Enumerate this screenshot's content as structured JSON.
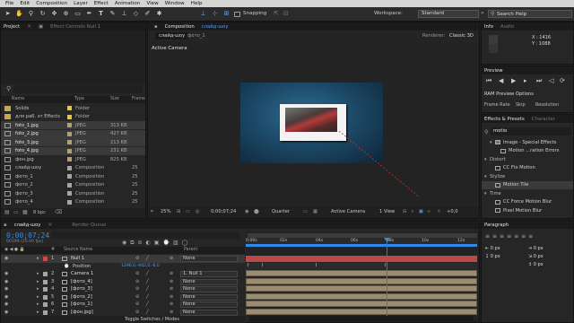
{
  "menu": [
    "File",
    "Edit",
    "Composition",
    "Layer",
    "Effect",
    "Animation",
    "View",
    "Window",
    "Help"
  ],
  "toolbar": {
    "snapping": "Snapping",
    "workspace_label": "Workspace:",
    "workspace_value": "Standard",
    "search_help": "Search Help"
  },
  "project": {
    "tab": "Project",
    "effect_controls_tab": "Effect Controls Null 1",
    "search_placeholder": "",
    "headers": {
      "name": "Name",
      "type": "Type",
      "size": "Size",
      "frame": "Frame"
    },
    "items": [
      {
        "name": "Solids",
        "type": "Folder",
        "size": "",
        "frame": "",
        "color": "#e7c44a",
        "kind": "folder"
      },
      {
        "name": "для ра6. эт Effects",
        "type": "Folder",
        "size": "",
        "frame": "",
        "color": "#e7c44a",
        "kind": "folder"
      },
      {
        "name": "foto_1.jpg",
        "type": "JPEG",
        "size": "313 KB",
        "frame": "",
        "color": "#b6a06d",
        "kind": "file",
        "selected": true
      },
      {
        "name": "foto_2.jpg",
        "type": "JPEG",
        "size": "427 KB",
        "frame": "",
        "color": "#b6a06d",
        "kind": "file",
        "selected": true
      },
      {
        "name": "foto_3.jpg",
        "type": "JPEG",
        "size": "213 KB",
        "frame": "",
        "color": "#b6a06d",
        "kind": "file",
        "selected": true
      },
      {
        "name": "foto_4.jpg",
        "type": "JPEG",
        "size": "231 KB",
        "frame": "",
        "color": "#b6a06d",
        "kind": "file",
        "selected": true
      },
      {
        "name": "фон.jpg",
        "type": "JPEG",
        "size": "825 KB",
        "frame": "",
        "color": "#b6a06d",
        "kind": "file"
      },
      {
        "name": "слайд-шоу",
        "type": "Composition",
        "size": "",
        "frame": "25",
        "color": "#a5a5a5",
        "kind": "comp"
      },
      {
        "name": "фото_1",
        "type": "Composition",
        "size": "",
        "frame": "25",
        "color": "#a5a5a5",
        "kind": "comp"
      },
      {
        "name": "фото_2",
        "type": "Composition",
        "size": "",
        "frame": "25",
        "color": "#a5a5a5",
        "kind": "comp"
      },
      {
        "name": "фото_3",
        "type": "Composition",
        "size": "",
        "frame": "25",
        "color": "#a5a5a5",
        "kind": "comp"
      },
      {
        "name": "фото_4",
        "type": "Composition",
        "size": "",
        "frame": "25",
        "color": "#a5a5a5",
        "kind": "comp"
      }
    ],
    "bpc": "8 bpc"
  },
  "composition": {
    "tab": "Composition",
    "tab_comp": "слайд-шоу",
    "subtab_active": "слайд-шоу",
    "subtab_other": "фото_1",
    "renderer_label": "Renderer:",
    "renderer_value": "Classic 3D",
    "view_label": "Active Camera",
    "footer": {
      "zoom": "25%",
      "time": "0;00;07;24",
      "resolution": "Quarter",
      "camera": "Active Camera",
      "views": "1 View",
      "offset": "+0,0"
    }
  },
  "info": {
    "tab": "Info",
    "audio_tab": "Audio",
    "x": "X : 1416",
    "y": "Y : 1088"
  },
  "preview": {
    "tab": "Preview",
    "ram": "RAM Preview Options",
    "frame_rate": "Frame Rate",
    "skip": "Skip",
    "resolution": "Resolution"
  },
  "effects": {
    "tab": "Effects & Presets",
    "char_tab": "Character",
    "search_value": "motio",
    "items": [
      {
        "label": "Image - Special Effects",
        "indent": 1,
        "kind": "folder"
      },
      {
        "label": "Motion ...ration Errors",
        "indent": 2,
        "kind": "effect"
      },
      {
        "label": "Distort",
        "indent": 0,
        "kind": "cat"
      },
      {
        "label": "CC Flo Motion",
        "indent": 1,
        "kind": "effect"
      },
      {
        "label": "Stylize",
        "indent": 0,
        "kind": "cat"
      },
      {
        "label": "Motion Tile",
        "indent": 1,
        "kind": "effect",
        "selected": true
      },
      {
        "label": "Time",
        "indent": 0,
        "kind": "cat"
      },
      {
        "label": "CC Force Motion Blur",
        "indent": 1,
        "kind": "effect"
      },
      {
        "label": "Pixel Motion Blur",
        "indent": 1,
        "kind": "effect"
      }
    ]
  },
  "paragraph": {
    "tab": "Paragraph",
    "px1": "0 px",
    "px2": "0 px",
    "px3": "0 px",
    "px4": "0 px",
    "px5": "0 px"
  },
  "timeline": {
    "tab": "слайд-шоу",
    "render_queue": "Render Queue",
    "time": "0;00;07;24",
    "frames": "00199 (25.00 fps)",
    "headers": {
      "num": "#",
      "source": "Source Name",
      "parent": "Parent"
    },
    "layers": [
      {
        "num": "1",
        "name": "Null 1",
        "parent": "None",
        "color": "#c94a4a",
        "selected": true
      },
      {
        "num": "",
        "name": "Position",
        "parent": "",
        "value": "1296,0,-942,0,-6,0",
        "sub": true
      },
      {
        "num": "2",
        "name": "Camera 1",
        "parent": "1. Null 1",
        "color": "#a5a5a5"
      },
      {
        "num": "3",
        "name": "[фото_4]",
        "parent": "None",
        "color": "#a5a5a5"
      },
      {
        "num": "4",
        "name": "[фото_3]",
        "parent": "None",
        "color": "#a5a5a5"
      },
      {
        "num": "5",
        "name": "[фото_2]",
        "parent": "None",
        "color": "#a5a5a5"
      },
      {
        "num": "6",
        "name": "[фото_1]",
        "parent": "None",
        "color": "#a5a5a5"
      },
      {
        "num": "7",
        "name": "[фон.jpg]",
        "parent": "None",
        "color": "#a5a5a5"
      }
    ],
    "ruler": [
      "0:00s",
      "02s",
      "04s",
      "06s",
      "08s",
      "10s",
      "12s"
    ],
    "toggle": "Toggle Switches / Modes"
  },
  "colors": {
    "accent": "#2d8ceb",
    "playhead": "#e03b3b",
    "layerbar": "#9a8c70"
  }
}
